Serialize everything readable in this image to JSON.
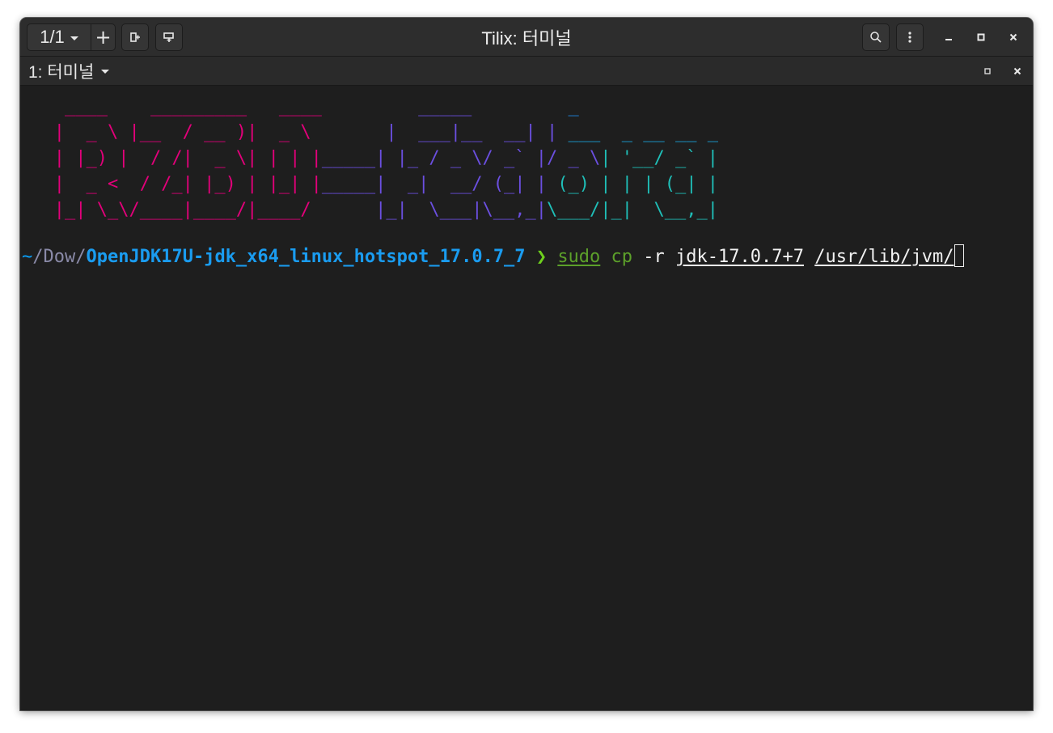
{
  "window": {
    "title": "Tilix: 터미널"
  },
  "headerbar": {
    "session_switcher_label": "1/1",
    "add_label": "+",
    "icons": {
      "session_switcher": "chevron-down-icon",
      "add": "plus-icon",
      "add_right": "split-right-icon",
      "add_down": "split-down-icon",
      "search": "search-icon",
      "menu": "kebab-menu-icon",
      "minimize": "minimize-icon",
      "maximize": "maximize-icon",
      "close": "close-icon"
    }
  },
  "tab": {
    "title": "1: 터미널",
    "icons": {
      "maximize": "maximize-terminal-icon",
      "close": "close-terminal-icon"
    }
  },
  "terminal": {
    "banner_lines": [
      [
        [
          "    ____    _________   ____",
          "#e2007a"
        ],
        [
          "         _____",
          "#6b4fe0"
        ],
        [
          "         _",
          "#1e88e5"
        ]
      ],
      [
        [
          "   |  _ \\ |__  / __ )|  _ \\",
          "#e2007a"
        ],
        [
          "       |  ___|__  __| |",
          "#6b4fe0"
        ],
        [
          " ___  _ __ __ _",
          "#1ba0d8"
        ]
      ],
      [
        [
          "   | |_) |  / /|  _ \\| | | |",
          "#e2007a"
        ],
        [
          "_____| |_ / _ \\/ _` |/ _ \\",
          "#6b4fe0"
        ],
        [
          "| '__/ _` |",
          "#1fbfb8"
        ]
      ],
      [
        [
          "   |  _ <  / /_| |_) | |_| |",
          "#e2007a"
        ],
        [
          "_____|  _|  __/ (_| |",
          "#6b4fe0"
        ],
        [
          " (_) | | | (_| |",
          "#1fbfb8"
        ]
      ],
      [
        [
          "   |_| \\_\\/____|____/|____/",
          "#e2007a"
        ],
        [
          "      |_|  \\___|\\__,_|",
          "#6b4fe0"
        ],
        [
          "\\___/|_|  \\__,_|",
          "#1fbfb8"
        ]
      ]
    ],
    "prompt": {
      "home": "~",
      "sep1": "/",
      "dir_short": "Dow",
      "sep2": "/",
      "dir_current": "OpenJDK17U-jdk_x64_linux_hotspot_17.0.7_7",
      "arrow": "❯",
      "cmd_sudo": "sudo",
      "cmd_cp": "cp",
      "arg_flag": "-r",
      "arg_src": "jdk-17.0.7+7",
      "arg_dst": "/usr/lib/jvm/"
    },
    "colors": {
      "home": "#0aa3ff",
      "dir_short": "#8a8aa8",
      "dir_current": "#1a9cf0",
      "arrow": "#6ed01d",
      "sudo": "#5ca02a",
      "cp": "#5ca02a",
      "args": "#f2f2f2"
    }
  }
}
